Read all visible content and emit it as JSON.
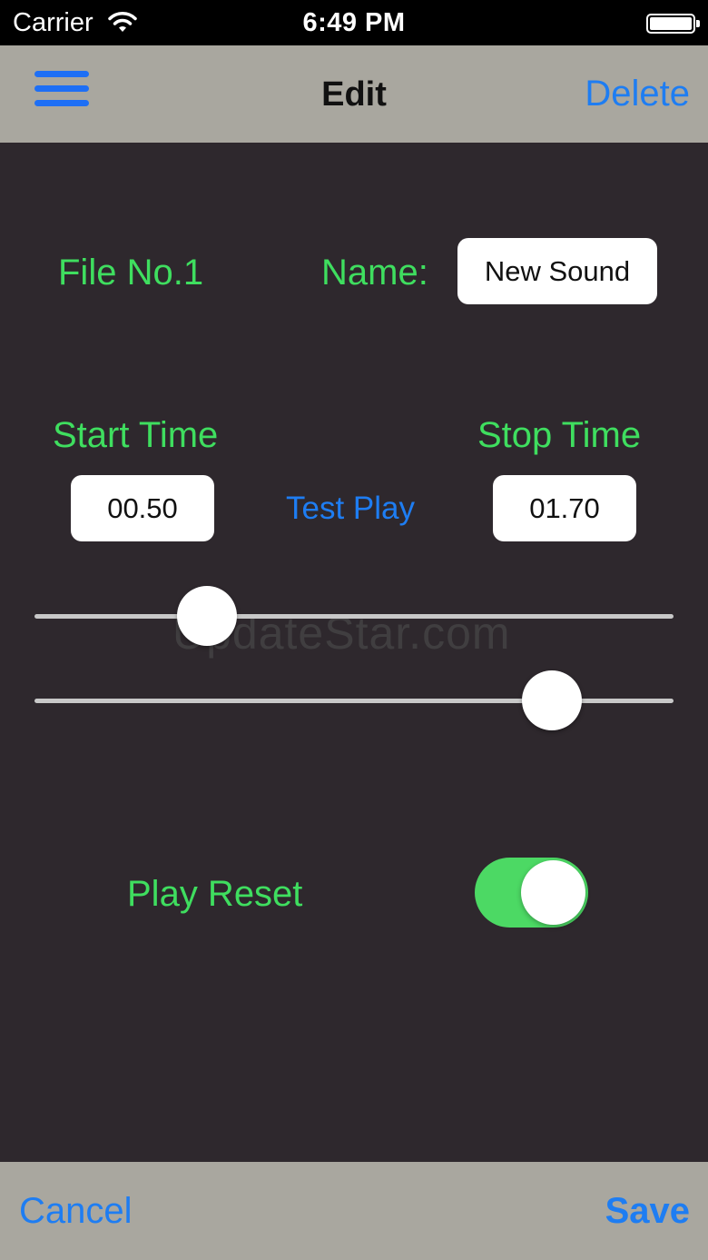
{
  "status_bar": {
    "carrier": "Carrier",
    "time": "6:49 PM",
    "wifi_icon": "wifi-icon",
    "battery_icon": "battery-icon"
  },
  "nav_bar": {
    "menu_icon": "hamburger-menu-icon",
    "title": "Edit",
    "delete_label": "Delete"
  },
  "file": {
    "file_label": "File No.1",
    "name_label": "Name:",
    "name_value": "New Sound"
  },
  "timing": {
    "start_label": "Start Time",
    "start_value": "00.50",
    "test_play_label": "Test Play",
    "stop_label": "Stop Time",
    "stop_value": "01.70"
  },
  "sliders": {
    "start_fraction": 0.27,
    "stop_fraction": 0.81
  },
  "watermark": "UpdateStar.com",
  "play_reset": {
    "label": "Play Reset",
    "on": true
  },
  "bottom_bar": {
    "cancel_label": "Cancel",
    "save_label": "Save"
  },
  "colors": {
    "accent_blue": "#1e7df2",
    "label_green": "#3fde5f",
    "toggle_on": "#4cd964",
    "background": "#2e282d",
    "bar_gray": "#a9a79f"
  }
}
